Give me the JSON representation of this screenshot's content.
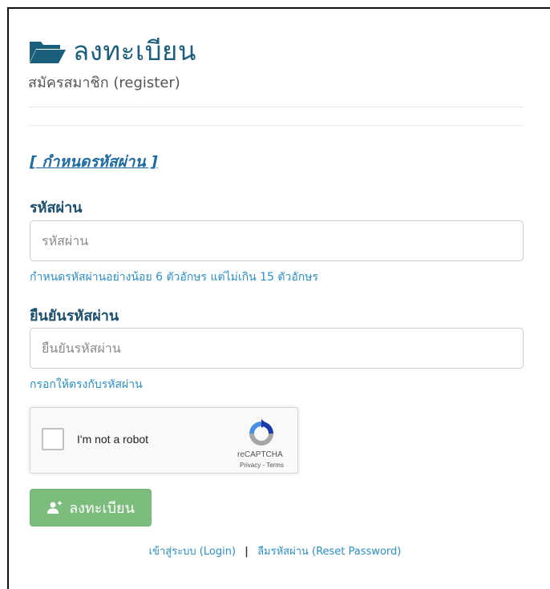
{
  "header": {
    "title": "ลงทะเบียน",
    "subtitle": "สมัครสมาชิก (register)",
    "icon": "folder-open-icon"
  },
  "section": {
    "link_label": "[ กำหนดรหัสผ่าน ]"
  },
  "password": {
    "label": "รหัสผ่าน",
    "placeholder": "รหัสผ่าน",
    "value": "",
    "help": "กำหนดรหัสผ่านอย่างน้อย 6 ตัวอักษร แต่ไม่เกิน 15 ตัวอักษร"
  },
  "confirm": {
    "label": "ยืนยันรหัสผ่าน",
    "placeholder": "ยืนยันรหัสผ่าน",
    "value": "",
    "help": "กรอกให้ตรงกับรหัสผ่าน"
  },
  "recaptcha": {
    "label": "I'm not a robot",
    "brand": "reCAPTCHA",
    "links": "Privacy - Terms"
  },
  "submit": {
    "label": "ลงทะเบียน",
    "icon": "user-add-icon"
  },
  "footer": {
    "login_label": "เข้าสู่ระบบ (Login)",
    "separator": "|",
    "reset_label": "ลืมรหัสผ่าน (Reset Password)"
  },
  "colors": {
    "title": "#1b5f7c",
    "label": "#1d4f6f",
    "link": "#2b8fc9",
    "submit": "#7cbc7c"
  }
}
